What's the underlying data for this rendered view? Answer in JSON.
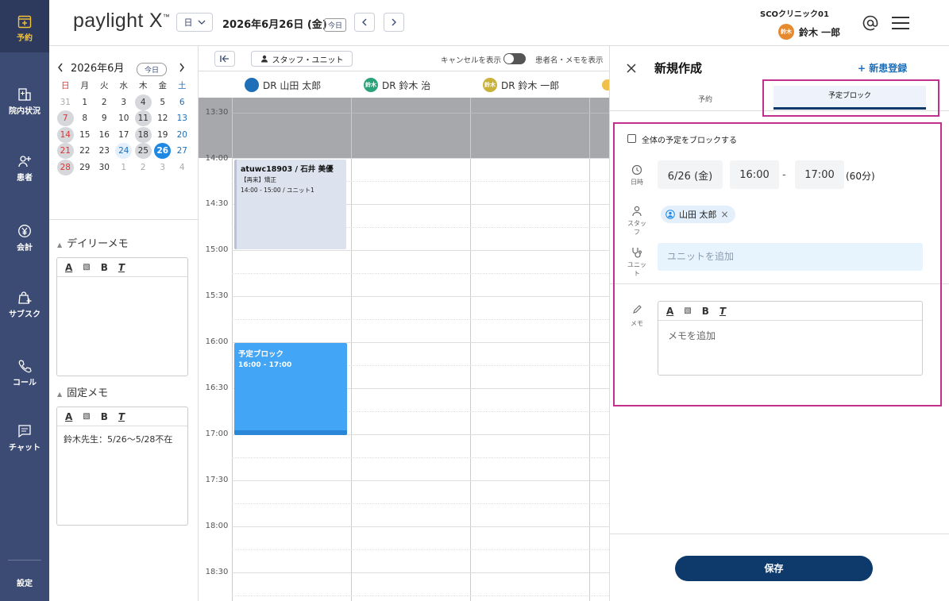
{
  "app": {
    "logo": "paylight X",
    "logo_mark": "™"
  },
  "sidebar": {
    "items": [
      {
        "label": "予約",
        "icon": "calendar-plus-icon"
      },
      {
        "label": "院内状況",
        "icon": "building-icon"
      },
      {
        "label": "患者",
        "icon": "user-add-icon"
      },
      {
        "label": "会計",
        "icon": "yen-coin-icon"
      },
      {
        "label": "サブスク",
        "icon": "bag-plus-icon"
      },
      {
        "label": "コール",
        "icon": "phone-icon"
      },
      {
        "label": "チャット",
        "icon": "chat-icon"
      }
    ],
    "settings_label": "設定"
  },
  "header": {
    "view_mode": "日",
    "date_title": "2026年6月26日 (金)",
    "today_label": "今日",
    "clinic_name": "SCOクリニック01",
    "user_avatar": "鈴木",
    "user_name": "鈴木 一郎"
  },
  "mini_calendar": {
    "title": "2026年6月",
    "today_label": "今日",
    "weekdays": [
      "日",
      "月",
      "火",
      "水",
      "木",
      "金",
      "土"
    ],
    "weeks": [
      [
        "31",
        "1",
        "2",
        "3",
        "4",
        "5",
        "6"
      ],
      [
        "7",
        "8",
        "9",
        "10",
        "11",
        "12",
        "13"
      ],
      [
        "14",
        "15",
        "16",
        "17",
        "18",
        "19",
        "20"
      ],
      [
        "21",
        "22",
        "23",
        "24",
        "25",
        "26",
        "27"
      ],
      [
        "28",
        "29",
        "30",
        "1",
        "2",
        "3",
        "4"
      ]
    ]
  },
  "daily_memo": {
    "title": "デイリーメモ",
    "content": ""
  },
  "fixed_memo": {
    "title": "固定メモ",
    "content": "鈴木先生：5/26〜5/28不在"
  },
  "calendar": {
    "collapse_icon": "collapse-left-icon",
    "staff_unit_label": "スタッフ・ユニット",
    "show_cancel_label": "キャンセルを表示",
    "show_patient_label": "患者名・メモを表示",
    "columns": [
      {
        "name": "DR 山田 太郎",
        "avatar": "",
        "avatar_color": "#1e6fb8"
      },
      {
        "name": "DR 鈴木 治",
        "avatar": "鈴木",
        "avatar_color": "#2aa37a"
      },
      {
        "name": "DR 鈴木 一郎",
        "avatar": "鈴木",
        "avatar_color": "#c9b13a"
      }
    ],
    "times": [
      "13:30",
      "14:00",
      "14:30",
      "15:00",
      "15:30",
      "16:00",
      "16:30",
      "17:00",
      "17:30",
      "18:00",
      "18:30"
    ],
    "appointment": {
      "patient_id": "atuwc18903",
      "patient_name": "石井 美優",
      "detail": "【再来】矯正",
      "time": "14:00 - 15:00 / ユニット1"
    },
    "block": {
      "title": "予定ブロック",
      "time": "16:00 - 17:00"
    }
  },
  "panel": {
    "title": "新規作成",
    "new_patient_label": "+ 新患登録",
    "tabs": [
      "予約",
      "予定ブロック"
    ],
    "active_tab": 1,
    "block_all_label": "全体の予定をブロックする",
    "datetime_label": "日時",
    "date": "6/26 (金)",
    "start_time": "16:00",
    "time_sep": "-",
    "end_time": "17:00",
    "duration": "(60分)",
    "staff_label": "スタッフ",
    "staff_chip": "山田 太郎",
    "unit_label": "ユニット",
    "unit_placeholder": "ユニットを追加",
    "memo_label": "メモ",
    "memo_placeholder": "メモを追加",
    "save_label": "保存"
  },
  "colors": {
    "sidebar": "#3c4b73",
    "accent": "#1e88e5",
    "block": "#42a5f5",
    "appointment": "#dde3ee",
    "highlight": "#c2308b",
    "save": "#0e3a6b"
  }
}
